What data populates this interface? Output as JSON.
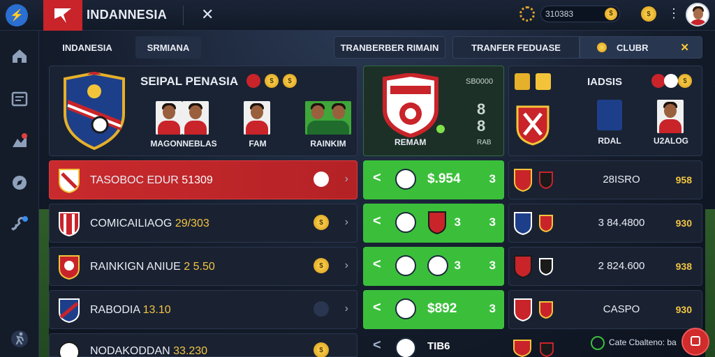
{
  "topbar": {
    "brand_name": "INDANNESIA",
    "close_label": "✕",
    "coins_value": "310383",
    "coin_glyph": "$",
    "menu_glyph": "⋮"
  },
  "tabs": [
    {
      "label": "INDANESIA"
    },
    {
      "label": "SRMIANA"
    },
    {
      "label": "TRANBERBER RIMAIN"
    },
    {
      "label": "TRANFER FEDUASE"
    },
    {
      "label": "CLUBR"
    }
  ],
  "club_panel": {
    "title": "SEIPAL PENASIA",
    "players": [
      {
        "label": "MAGONNEBLAS"
      },
      {
        "label": "FAM"
      },
      {
        "label": "RAINKIM"
      }
    ]
  },
  "feature_panel": {
    "code": "SB0000",
    "big_digits": "8\n8",
    "label": "REMAM",
    "sub": "RAB"
  },
  "right_panel": {
    "title": "IADSIS",
    "labels": [
      {
        "label": "RDAL"
      },
      {
        "label": "U2ALOG"
      }
    ]
  },
  "rows": [
    {
      "name": "TASOBOC EDUR",
      "value": "51309"
    },
    {
      "name": "COMICAILIAOG",
      "value": "29/303"
    },
    {
      "name": "RAINKIGN ANIUE",
      "value": "2 5.50"
    },
    {
      "name": "RABODIA",
      "value": "13.10"
    },
    {
      "name": "NODAKODDAN",
      "value": "33.230"
    }
  ],
  "mid_rows": [
    {
      "arrow": "<",
      "price": "$.954",
      "n": "3"
    },
    {
      "arrow": "<",
      "price": "",
      "n": "3",
      "n2": "3"
    },
    {
      "arrow": "<",
      "price": "",
      "n": "3",
      "n2": "3"
    },
    {
      "arrow": "<",
      "price": "$892",
      "n": "3"
    },
    {
      "arrow": "<",
      "price": "TIB6",
      "n": ""
    }
  ],
  "right_rows": [
    {
      "label": "28ISRO",
      "score": "958"
    },
    {
      "label": "3 84.4800",
      "score": "930"
    },
    {
      "label": "2 824.600",
      "score": "938"
    },
    {
      "label": "CASPO",
      "score": "930"
    }
  ],
  "chat": {
    "label": "Cate Cbalteno: ba"
  },
  "colors": {
    "accent_red": "#c92a2d",
    "accent_green": "#3bbf3b",
    "gold": "#f4c542"
  }
}
